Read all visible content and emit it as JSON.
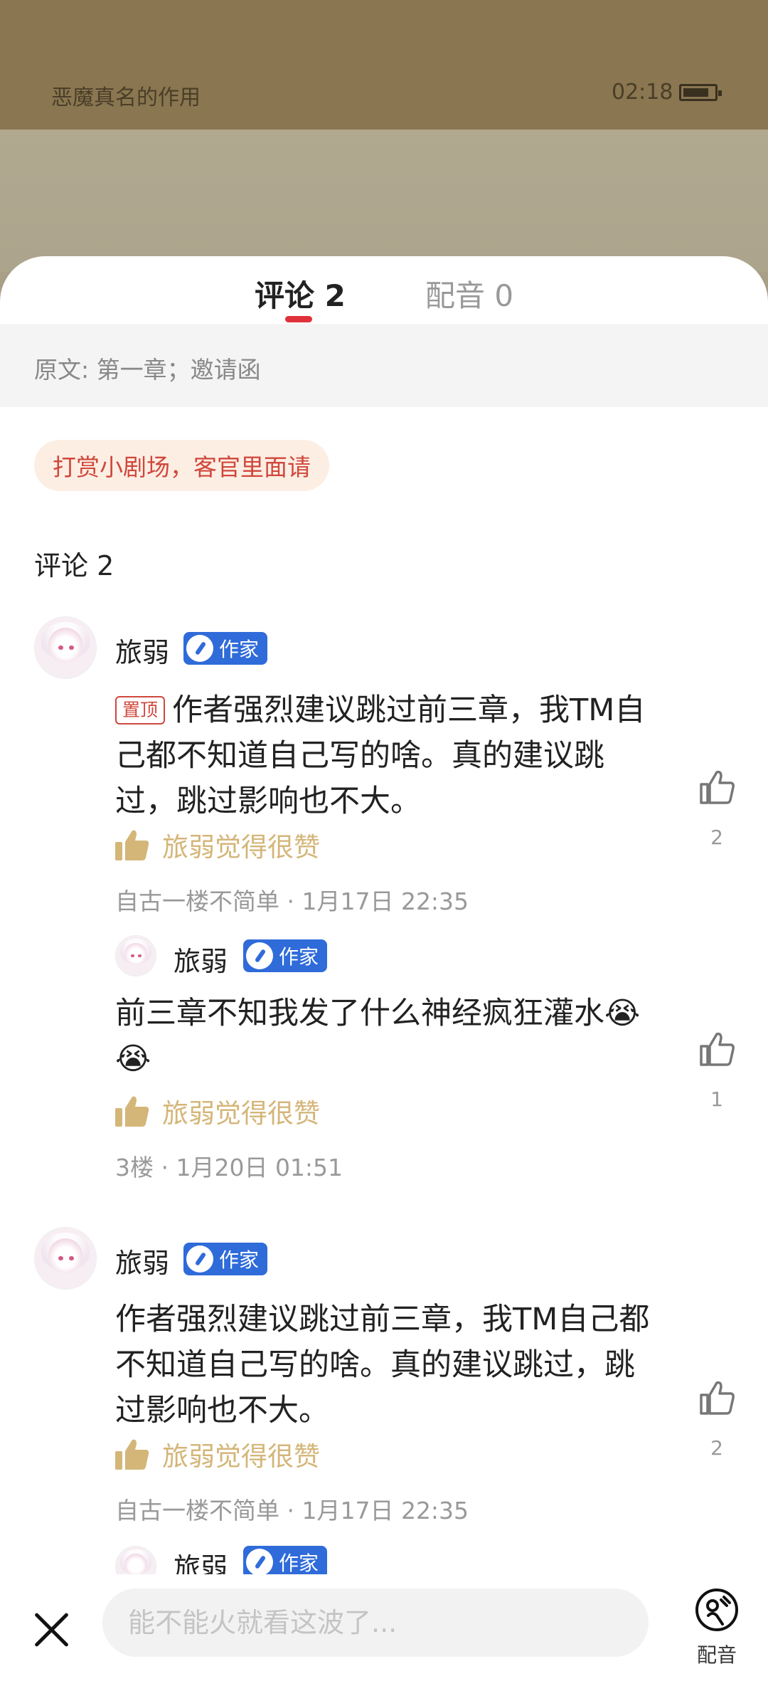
{
  "status": {
    "book_title": "恶魔真名的作用",
    "time": "02:18",
    "battery_level": 0.85
  },
  "tabs": [
    {
      "label": "评论 2",
      "active": true
    },
    {
      "label": "配音 0",
      "active": false
    }
  ],
  "origin": "原文: 第一章；邀请函",
  "tip_pill": "打赏小剧场，客官里面请",
  "comment_count_label": "评论 2",
  "comments": [
    {
      "user": "旅弱",
      "badge": "作家",
      "pin_tag": "置顶",
      "text": "作者强烈建议跳过前三章，我TM自己都不知道自己写的啥。真的建议跳过，跳过影响也不大。",
      "liked_by": "旅弱觉得很赞",
      "meta": "自古一楼不简单 · 1月17日 22:35",
      "likes": "2"
    },
    {
      "user": "旅弱",
      "badge": "作家",
      "text": "前三章不知我发了什么神经疯狂灌水😭😭",
      "liked_by": "旅弱觉得很赞",
      "meta": "3楼 · 1月20日 01:51",
      "likes": "1"
    },
    {
      "user": "旅弱",
      "badge": "作家",
      "text": "作者强烈建议跳过前三章，我TM自己都不知道自己写的啥。真的建议跳过，跳过影响也不大。",
      "liked_by": "旅弱觉得很赞",
      "meta": "自古一楼不简单 · 1月17日 22:35",
      "likes": "2"
    },
    {
      "user": "旅弱",
      "badge": "作家"
    }
  ],
  "bottom": {
    "placeholder": "能不能火就看这波了...",
    "dub_label": "配音"
  },
  "colors": {
    "accent_red": "#e0313a",
    "badge_blue": "#2f6bd9",
    "liked_gold": "#d4b679"
  }
}
